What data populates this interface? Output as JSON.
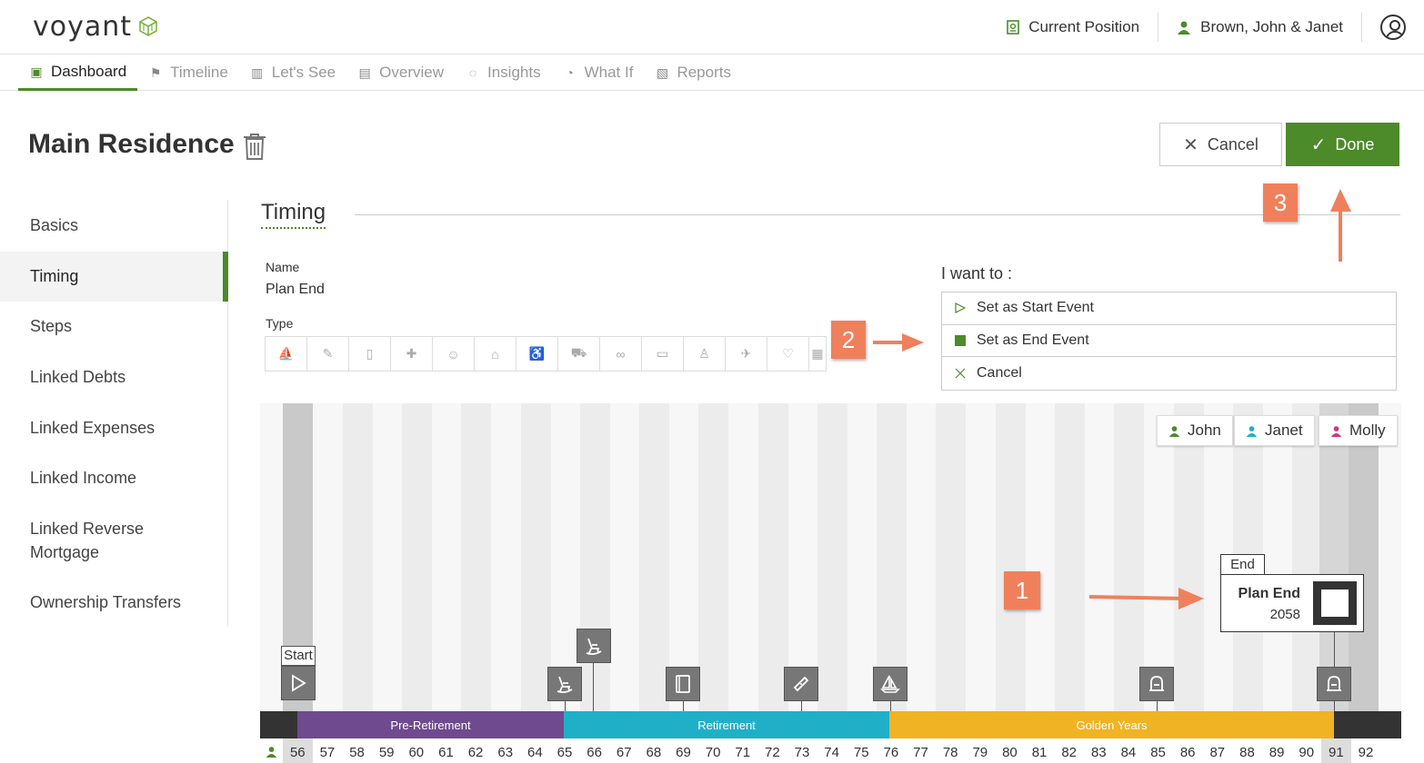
{
  "app": {
    "logo_text": "voyant",
    "current_position": "Current Position",
    "client_name": "Brown, John & Janet"
  },
  "nav": {
    "tabs": [
      {
        "label": "Dashboard",
        "icon": "dashboard-icon",
        "active": true
      },
      {
        "label": "Timeline",
        "icon": "flag-icon"
      },
      {
        "label": "Let's See",
        "icon": "bar-chart-icon"
      },
      {
        "label": "Overview",
        "icon": "document-icon"
      },
      {
        "label": "Insights",
        "icon": "lightbulb-icon"
      },
      {
        "label": "What If",
        "icon": "pie-chart-icon"
      },
      {
        "label": "Reports",
        "icon": "pdf-icon"
      }
    ]
  },
  "page": {
    "title": "Main Residence",
    "cancel_label": "Cancel",
    "done_label": "Done"
  },
  "sidebar": {
    "items": [
      {
        "label": "Basics"
      },
      {
        "label": "Timing",
        "active": true
      },
      {
        "label": "Steps"
      },
      {
        "label": "Linked Debts"
      },
      {
        "label": "Linked Expenses"
      },
      {
        "label": "Linked Income"
      },
      {
        "label": "Linked Reverse Mortgage"
      },
      {
        "label": "Ownership Transfers"
      }
    ]
  },
  "timing": {
    "section_title": "Timing",
    "name_label": "Name",
    "name_value": "Plan End",
    "type_label": "Type",
    "type_icons": [
      "sailboat-icon",
      "party-icon",
      "book-icon",
      "bandage-icon",
      "baby-icon",
      "house-icon",
      "rocker-icon",
      "car-icon",
      "rings-icon",
      "paint-roller-icon",
      "person-icon",
      "plane-icon",
      "heart-ring-icon",
      "calendar-icon"
    ]
  },
  "iwant": {
    "title": "I want to :",
    "options": [
      {
        "label": "Set as Start Event",
        "icon": "play-outline-icon"
      },
      {
        "label": "Set as End Event",
        "icon": "square-filled-icon"
      },
      {
        "label": "Cancel",
        "icon": "close-icon"
      }
    ]
  },
  "callouts": {
    "one": "1",
    "two": "2",
    "three": "3"
  },
  "legend": [
    {
      "label": "John",
      "color": "#4c8a2a"
    },
    {
      "label": "Janet",
      "color": "#1ab0c8"
    },
    {
      "label": "Molly",
      "color": "#d6337a"
    }
  ],
  "phases": [
    {
      "label": "Pre-Retirement",
      "color": "#6f4a8e"
    },
    {
      "label": "Retirement",
      "color": "#1fb0c8"
    },
    {
      "label": "Golden Years",
      "color": "#f0b323"
    }
  ],
  "timeline": {
    "start_label": "Start",
    "end_label": "End",
    "end_event_name": "Plan End",
    "end_event_year": "2058",
    "ages": [
      "56",
      "57",
      "58",
      "59",
      "60",
      "61",
      "62",
      "63",
      "64",
      "65",
      "66",
      "67",
      "68",
      "69",
      "70",
      "71",
      "72",
      "73",
      "74",
      "75",
      "76",
      "77",
      "78",
      "79",
      "80",
      "81",
      "82",
      "83",
      "84",
      "85",
      "86",
      "87",
      "88",
      "89",
      "90",
      "91",
      "92"
    ],
    "events": [
      {
        "icon": "play-outline-icon"
      },
      {
        "icon": "rocker-icon"
      },
      {
        "icon": "rocker-icon"
      },
      {
        "icon": "book-icon"
      },
      {
        "icon": "bandage-icon"
      },
      {
        "icon": "sailboat-icon"
      },
      {
        "icon": "tombstone-icon"
      },
      {
        "icon": "tombstone-icon"
      }
    ]
  }
}
